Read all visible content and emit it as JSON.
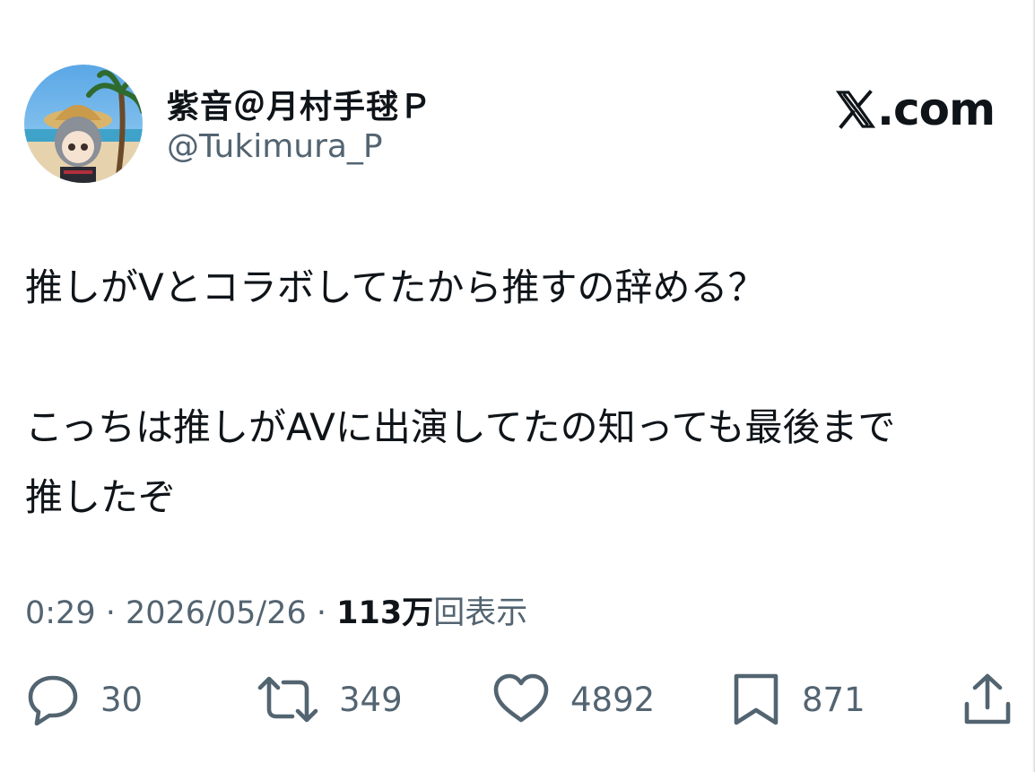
{
  "author": {
    "display_name": "紫音＠月村手毬Ｐ",
    "handle": "@Tukimura_P"
  },
  "brand": {
    "site_label": ".com",
    "logo_icon": "x-logo-icon"
  },
  "tweet": {
    "lines": [
      "推しがVとコラボしてたから推すの辞める？",
      "",
      "こっちは推しがAVに出演してたの知っても最後まで",
      "推したぞ"
    ]
  },
  "meta": {
    "time": "0:29",
    "separator": " · ",
    "date": "2026/05/26",
    "views_count": "113万",
    "views_label": "回表示"
  },
  "actions": {
    "reply": {
      "icon": "reply-icon",
      "count": "30"
    },
    "repost": {
      "icon": "repost-icon",
      "count": "349"
    },
    "like": {
      "icon": "heart-icon",
      "count": "4892"
    },
    "bookmark": {
      "icon": "bookmark-icon",
      "count": "871"
    },
    "share": {
      "icon": "share-icon"
    }
  },
  "colors": {
    "text_primary": "#0f1419",
    "text_secondary": "#536471",
    "background": "#ffffff"
  }
}
